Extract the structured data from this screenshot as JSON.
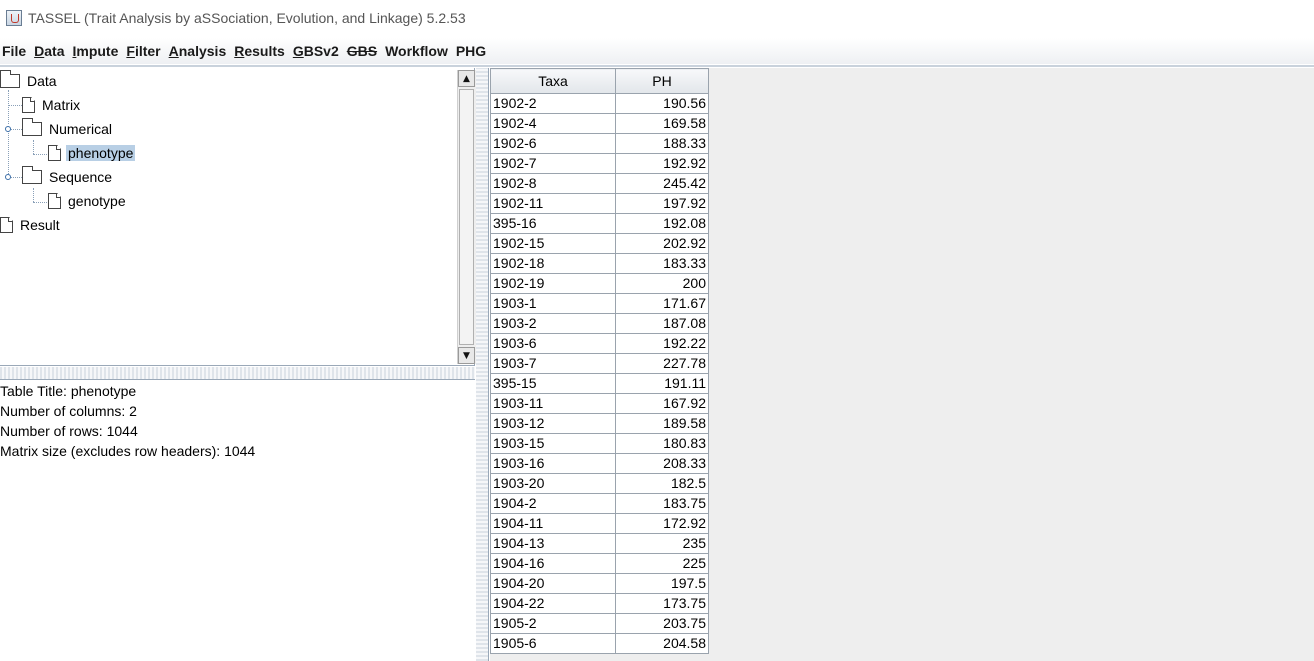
{
  "window": {
    "title": "TASSEL (Trait Analysis by aSSociation, Evolution, and Linkage) 5.2.53"
  },
  "menu": [
    "File",
    "Data",
    "Impute",
    "Filter",
    "Analysis",
    "Results",
    "GBSv2",
    "GBS",
    "Workflow",
    "PHG"
  ],
  "tree": {
    "root": "Data",
    "matrix": "Matrix",
    "numerical": "Numerical",
    "phenotype": "phenotype",
    "sequence": "Sequence",
    "genotype": "genotype",
    "result": "Result"
  },
  "info": {
    "line1": "Table Title: phenotype",
    "line2": "Number of columns: 2",
    "line3": "Number of rows: 1044",
    "line4": "Matrix size (excludes row headers): 1044"
  },
  "table": {
    "headers": [
      "Taxa",
      "PH"
    ],
    "rows": [
      [
        "1902-2",
        "190.56"
      ],
      [
        "1902-4",
        "169.58"
      ],
      [
        "1902-6",
        "188.33"
      ],
      [
        "1902-7",
        "192.92"
      ],
      [
        "1902-8",
        "245.42"
      ],
      [
        "1902-11",
        "197.92"
      ],
      [
        "395-16",
        "192.08"
      ],
      [
        "1902-15",
        "202.92"
      ],
      [
        "1902-18",
        "183.33"
      ],
      [
        "1902-19",
        "200"
      ],
      [
        "1903-1",
        "171.67"
      ],
      [
        "1903-2",
        "187.08"
      ],
      [
        "1903-6",
        "192.22"
      ],
      [
        "1903-7",
        "227.78"
      ],
      [
        "395-15",
        "191.11"
      ],
      [
        "1903-11",
        "167.92"
      ],
      [
        "1903-12",
        "189.58"
      ],
      [
        "1903-15",
        "180.83"
      ],
      [
        "1903-16",
        "208.33"
      ],
      [
        "1903-20",
        "182.5"
      ],
      [
        "1904-2",
        "183.75"
      ],
      [
        "1904-11",
        "172.92"
      ],
      [
        "1904-13",
        "235"
      ],
      [
        "1904-16",
        "225"
      ],
      [
        "1904-20",
        "197.5"
      ],
      [
        "1904-22",
        "173.75"
      ],
      [
        "1905-2",
        "203.75"
      ],
      [
        "1905-6",
        "204.58"
      ]
    ]
  }
}
